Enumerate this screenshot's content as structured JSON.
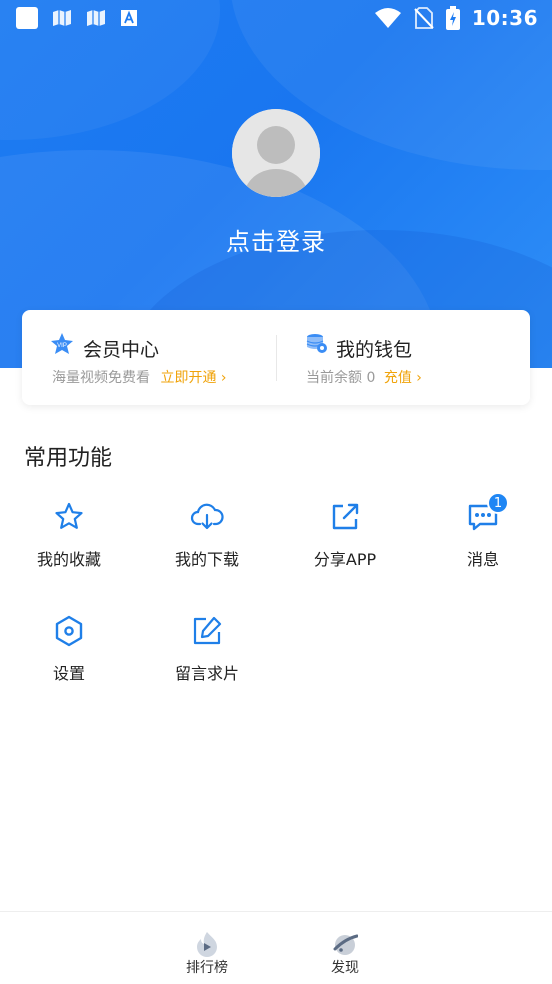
{
  "status_bar": {
    "time": "10:36"
  },
  "profile": {
    "login_label": "点击登录"
  },
  "vip": {
    "title": "会员中心",
    "subtitle": "海量视频免费看",
    "action": "立即开通",
    "arrow": "›",
    "badge_text": "VIP"
  },
  "wallet": {
    "title": "我的钱包",
    "subtitle": "当前余额",
    "balance": "0",
    "action": "充值",
    "arrow": "›"
  },
  "functions": {
    "title": "常用功能",
    "items": [
      {
        "label": "我的收藏",
        "icon": "star-icon"
      },
      {
        "label": "我的下载",
        "icon": "cloud-download-icon"
      },
      {
        "label": "分享APP",
        "icon": "share-icon"
      },
      {
        "label": "消息",
        "icon": "message-icon",
        "badge": "1"
      },
      {
        "label": "设置",
        "icon": "settings-hexagon-icon"
      },
      {
        "label": "留言求片",
        "icon": "edit-icon"
      }
    ]
  },
  "tabbar": {
    "items": [
      {
        "label": "排行榜",
        "icon": "ranking-flame-icon"
      },
      {
        "label": "发现",
        "icon": "discover-planet-icon"
      }
    ]
  },
  "colors": {
    "primary": "#1e7cf2",
    "accent": "#f0a30a",
    "icon_blue": "#1f7fe8"
  }
}
